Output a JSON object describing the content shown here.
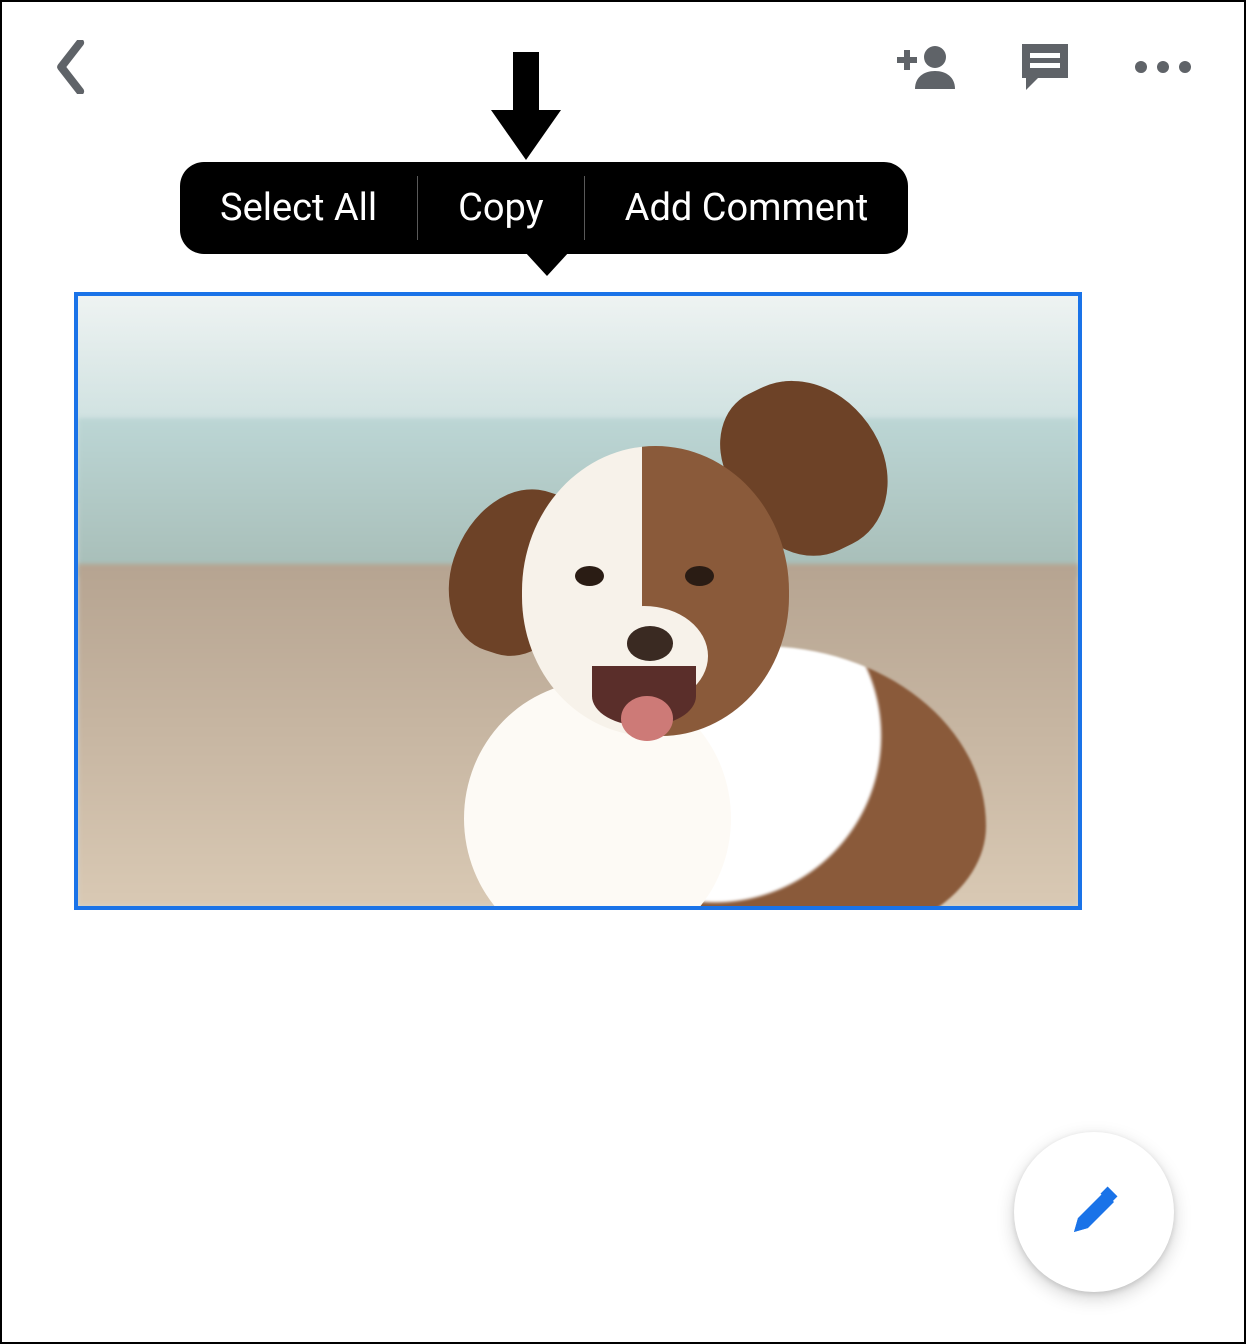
{
  "context_menu": {
    "select_all": "Select All",
    "copy": "Copy",
    "add_comment": "Add Comment"
  },
  "colors": {
    "selection_border": "#1a73e8",
    "fab_icon": "#1a73e8",
    "toolbar_icon": "#5f6368"
  },
  "image": {
    "description": "dog-photo",
    "selected": true
  }
}
